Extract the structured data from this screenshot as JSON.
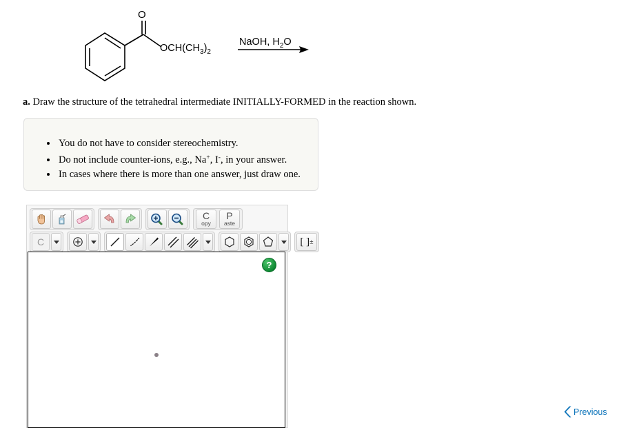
{
  "reaction": {
    "reactant_name": "isopropyl benzoate",
    "ester_group_label": "OCH(CH",
    "ester_sub_3": "3",
    "ester_close": ")",
    "ester_sub_2": "2",
    "carbonyl_oxygen": "O",
    "reagents_prefix": "NaOH, H",
    "reagents_sub": "2",
    "reagents_suffix": "O"
  },
  "question": {
    "label": "a.",
    "text": "Draw the structure of the tetrahedral intermediate INITIALLY-FORMED in the reaction shown."
  },
  "instructions": {
    "items": [
      {
        "pre": "You do not have to consider stereochemistry.",
        "sup1": "",
        "mid": "",
        "sup2": "",
        "post": ""
      },
      {
        "pre": "Do not include counter-ions, e.g., Na",
        "sup1": "+",
        "mid": ", I",
        "sup2": "-",
        "post": ", in your answer."
      },
      {
        "pre": "In cases where there is more than one answer, just draw one.",
        "sup1": "",
        "mid": "",
        "sup2": "",
        "post": ""
      }
    ]
  },
  "sketcher": {
    "toolbar_row1": [
      {
        "name": "pan-hand-tool",
        "icon": "hand-icon",
        "label": ""
      },
      {
        "name": "clean-structure-tool",
        "icon": "spray-bottle-icon",
        "label": ""
      },
      {
        "name": "eraser-tool",
        "icon": "eraser-icon",
        "label": ""
      },
      {
        "name": "undo-tool",
        "icon": "undo-arrow-icon",
        "label": ""
      },
      {
        "name": "redo-tool",
        "icon": "redo-arrow-icon",
        "label": ""
      },
      {
        "name": "zoom-in-tool",
        "icon": "zoom-in-icon",
        "label": ""
      },
      {
        "name": "zoom-out-tool",
        "icon": "zoom-out-icon",
        "label": ""
      }
    ],
    "copy_button": {
      "big": "C",
      "small": "opy"
    },
    "paste_button": {
      "big": "P",
      "small": "aste"
    },
    "element_button": {
      "label": "C",
      "name": "carbon-element-tool"
    },
    "charge_button": {
      "name": "charge-tool",
      "icon": "plus-circle-icon"
    },
    "bond_tools": [
      {
        "name": "single-bond-tool",
        "selected": true
      },
      {
        "name": "hashed-wedge-bond-tool",
        "selected": false
      },
      {
        "name": "bold-wedge-bond-tool",
        "selected": false
      },
      {
        "name": "double-bond-tool",
        "selected": false
      },
      {
        "name": "triple-bond-tool",
        "selected": false
      }
    ],
    "ring_tools": [
      {
        "name": "cyclohexane-ring-tool"
      },
      {
        "name": "benzene-ring-tool"
      },
      {
        "name": "cyclopentane-ring-tool"
      }
    ],
    "bracket_charge_button": {
      "label": "[ ]",
      "sup": "±",
      "name": "bracket-charge-tool"
    },
    "help_button": {
      "label": "?",
      "name": "help-button"
    }
  },
  "footer": {
    "previous_label": "Previous"
  },
  "colors": {
    "link_blue": "#1076bb",
    "help_green": "#0f8a34",
    "box_bg": "#f8f8f4",
    "panel_bg": "#f7f7f7"
  }
}
